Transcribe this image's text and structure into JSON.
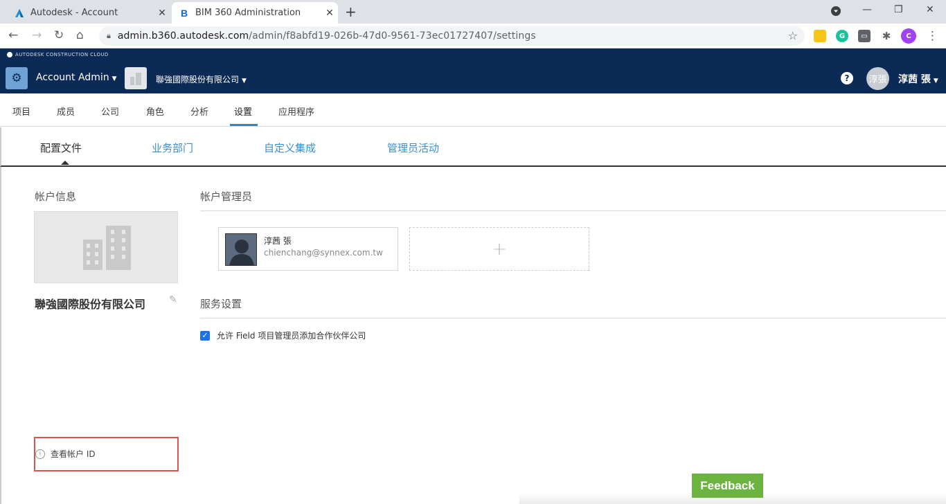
{
  "browser": {
    "tabs": [
      {
        "title": "Autodesk - Account",
        "favicon": "A"
      },
      {
        "title": "BIM 360 Administration",
        "favicon": "B"
      }
    ],
    "url_host": "admin.b360.autodesk.com",
    "url_path": "/admin/f8abfd19-026b-47d0-9561-73ec01727407/settings",
    "profile_initial": "C"
  },
  "header": {
    "brand": "AUTODESK CONSTRUCTION CLOUD",
    "app_title": "Account Admin",
    "company": "聯強國際股份有限公司",
    "user_avatar": "淳張",
    "user_name": "淳茜 張"
  },
  "main_nav": {
    "items": [
      "项目",
      "成员",
      "公司",
      "角色",
      "分析",
      "设置",
      "应用程序"
    ],
    "active": "设置"
  },
  "sub_tabs": {
    "items": [
      "配置文件",
      "业务部门",
      "自定义集成",
      "管理员活动"
    ],
    "active": "配置文件"
  },
  "account_info": {
    "title": "帐户信息",
    "company_name": "聯強國際股份有限公司",
    "view_account_id": "查看帐户 ID"
  },
  "account_admins": {
    "title": "帐户管理员",
    "admins": [
      {
        "name": "淳茜 張",
        "email": "chienchang@synnex.com.tw"
      }
    ],
    "add_symbol": "+"
  },
  "service_settings": {
    "title": "服务设置",
    "options": [
      {
        "label": "允许 Field 项目管理员添加合作伙伴公司",
        "checked": true
      }
    ]
  },
  "feedback": {
    "label": "Feedback"
  },
  "colors": {
    "header_bg": "#0b2a55",
    "accent_blue": "#3a8fce",
    "feedback_green": "#6db33f",
    "highlight_red": "#d9534f"
  }
}
